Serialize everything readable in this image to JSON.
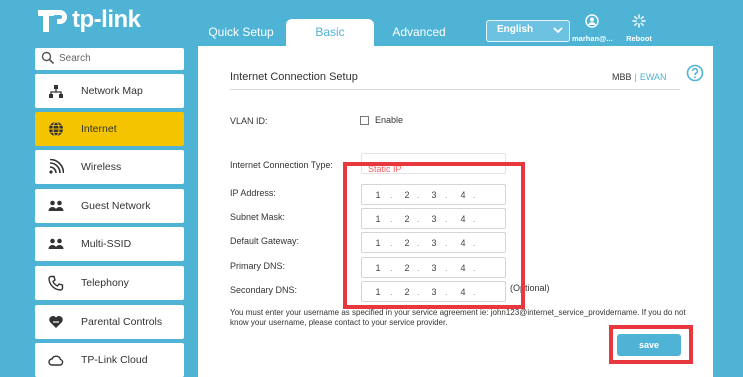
{
  "brand": {
    "name": "tp-link"
  },
  "nav": {
    "tabs": [
      {
        "label": "Quick Setup",
        "active": false
      },
      {
        "label": "Basic",
        "active": true
      },
      {
        "label": "Advanced",
        "active": false
      }
    ]
  },
  "header": {
    "language": "English",
    "user_label": "marhan@...",
    "reboot_label": "Reboot"
  },
  "sidebar": {
    "search_placeholder": "Search",
    "items": [
      {
        "label": "Network Map",
        "icon": "network-map-icon",
        "active": false
      },
      {
        "label": "Internet",
        "icon": "globe-icon",
        "active": true
      },
      {
        "label": "Wireless",
        "icon": "wifi-icon",
        "active": false
      },
      {
        "label": "Guest Network",
        "icon": "guest-network-icon",
        "active": false
      },
      {
        "label": "Multi-SSID",
        "icon": "multi-ssid-icon",
        "active": false
      },
      {
        "label": "Telephony",
        "icon": "phone-icon",
        "active": false
      },
      {
        "label": "Parental Controls",
        "icon": "heart-icon",
        "active": false
      },
      {
        "label": "TP-Link Cloud",
        "icon": "cloud-icon",
        "active": false
      }
    ]
  },
  "main": {
    "title": "Internet Connection Setup",
    "mode_mbb": "MBB",
    "mode_separator": "|",
    "mode_ewan": "EWAN",
    "vlan_label": "VLAN ID:",
    "vlan_enable_label": "Enable",
    "vlan_enabled": false,
    "conn_type_label": "Internet Connection Type:",
    "conn_type_value": "Static IP",
    "fields": [
      {
        "label": "IP Address:",
        "octets": [
          "1",
          "2",
          "3",
          "4"
        ]
      },
      {
        "label": "Subnet Mask:",
        "octets": [
          "1",
          "2",
          "3",
          "4"
        ]
      },
      {
        "label": "Default Gateway:",
        "octets": [
          "1",
          "2",
          "3",
          "4"
        ]
      },
      {
        "label": "Primary DNS:",
        "octets": [
          "1",
          "2",
          "3",
          "4"
        ]
      },
      {
        "label": "Secondary DNS:",
        "octets": [
          "1",
          "2",
          "3",
          "4"
        ]
      }
    ],
    "optional_label": "(Optional)",
    "note": "You must enter your username as specified in your service agreement ie: john123@internet_service_providername. If you do not know your username, please contact to your service provider.",
    "save_label": "save"
  },
  "colors": {
    "brand_blue": "#4fb3d6",
    "active_yellow": "#f5c400",
    "highlight_red": "#e8383e"
  }
}
